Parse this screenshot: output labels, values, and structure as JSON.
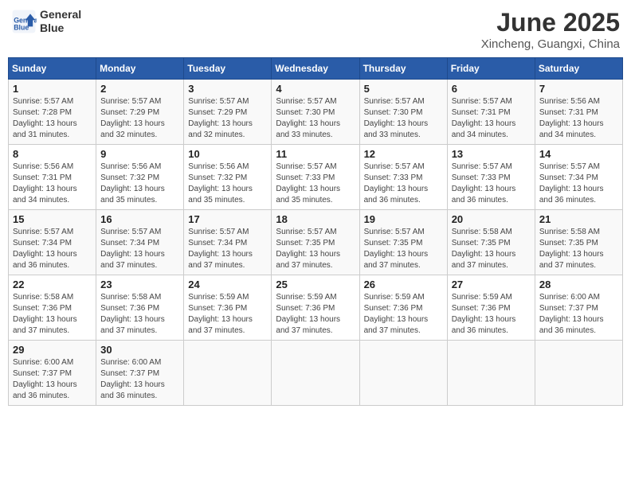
{
  "header": {
    "logo_line1": "General",
    "logo_line2": "Blue",
    "title": "June 2025",
    "subtitle": "Xincheng, Guangxi, China"
  },
  "weekdays": [
    "Sunday",
    "Monday",
    "Tuesday",
    "Wednesday",
    "Thursday",
    "Friday",
    "Saturday"
  ],
  "weeks": [
    [
      {
        "day": 1,
        "info": "Sunrise: 5:57 AM\nSunset: 7:28 PM\nDaylight: 13 hours\nand 31 minutes."
      },
      {
        "day": 2,
        "info": "Sunrise: 5:57 AM\nSunset: 7:29 PM\nDaylight: 13 hours\nand 32 minutes."
      },
      {
        "day": 3,
        "info": "Sunrise: 5:57 AM\nSunset: 7:29 PM\nDaylight: 13 hours\nand 32 minutes."
      },
      {
        "day": 4,
        "info": "Sunrise: 5:57 AM\nSunset: 7:30 PM\nDaylight: 13 hours\nand 33 minutes."
      },
      {
        "day": 5,
        "info": "Sunrise: 5:57 AM\nSunset: 7:30 PM\nDaylight: 13 hours\nand 33 minutes."
      },
      {
        "day": 6,
        "info": "Sunrise: 5:57 AM\nSunset: 7:31 PM\nDaylight: 13 hours\nand 34 minutes."
      },
      {
        "day": 7,
        "info": "Sunrise: 5:56 AM\nSunset: 7:31 PM\nDaylight: 13 hours\nand 34 minutes."
      }
    ],
    [
      {
        "day": 8,
        "info": "Sunrise: 5:56 AM\nSunset: 7:31 PM\nDaylight: 13 hours\nand 34 minutes."
      },
      {
        "day": 9,
        "info": "Sunrise: 5:56 AM\nSunset: 7:32 PM\nDaylight: 13 hours\nand 35 minutes."
      },
      {
        "day": 10,
        "info": "Sunrise: 5:56 AM\nSunset: 7:32 PM\nDaylight: 13 hours\nand 35 minutes."
      },
      {
        "day": 11,
        "info": "Sunrise: 5:57 AM\nSunset: 7:33 PM\nDaylight: 13 hours\nand 35 minutes."
      },
      {
        "day": 12,
        "info": "Sunrise: 5:57 AM\nSunset: 7:33 PM\nDaylight: 13 hours\nand 36 minutes."
      },
      {
        "day": 13,
        "info": "Sunrise: 5:57 AM\nSunset: 7:33 PM\nDaylight: 13 hours\nand 36 minutes."
      },
      {
        "day": 14,
        "info": "Sunrise: 5:57 AM\nSunset: 7:34 PM\nDaylight: 13 hours\nand 36 minutes."
      }
    ],
    [
      {
        "day": 15,
        "info": "Sunrise: 5:57 AM\nSunset: 7:34 PM\nDaylight: 13 hours\nand 36 minutes."
      },
      {
        "day": 16,
        "info": "Sunrise: 5:57 AM\nSunset: 7:34 PM\nDaylight: 13 hours\nand 37 minutes."
      },
      {
        "day": 17,
        "info": "Sunrise: 5:57 AM\nSunset: 7:34 PM\nDaylight: 13 hours\nand 37 minutes."
      },
      {
        "day": 18,
        "info": "Sunrise: 5:57 AM\nSunset: 7:35 PM\nDaylight: 13 hours\nand 37 minutes."
      },
      {
        "day": 19,
        "info": "Sunrise: 5:57 AM\nSunset: 7:35 PM\nDaylight: 13 hours\nand 37 minutes."
      },
      {
        "day": 20,
        "info": "Sunrise: 5:58 AM\nSunset: 7:35 PM\nDaylight: 13 hours\nand 37 minutes."
      },
      {
        "day": 21,
        "info": "Sunrise: 5:58 AM\nSunset: 7:35 PM\nDaylight: 13 hours\nand 37 minutes."
      }
    ],
    [
      {
        "day": 22,
        "info": "Sunrise: 5:58 AM\nSunset: 7:36 PM\nDaylight: 13 hours\nand 37 minutes."
      },
      {
        "day": 23,
        "info": "Sunrise: 5:58 AM\nSunset: 7:36 PM\nDaylight: 13 hours\nand 37 minutes."
      },
      {
        "day": 24,
        "info": "Sunrise: 5:59 AM\nSunset: 7:36 PM\nDaylight: 13 hours\nand 37 minutes."
      },
      {
        "day": 25,
        "info": "Sunrise: 5:59 AM\nSunset: 7:36 PM\nDaylight: 13 hours\nand 37 minutes."
      },
      {
        "day": 26,
        "info": "Sunrise: 5:59 AM\nSunset: 7:36 PM\nDaylight: 13 hours\nand 37 minutes."
      },
      {
        "day": 27,
        "info": "Sunrise: 5:59 AM\nSunset: 7:36 PM\nDaylight: 13 hours\nand 36 minutes."
      },
      {
        "day": 28,
        "info": "Sunrise: 6:00 AM\nSunset: 7:37 PM\nDaylight: 13 hours\nand 36 minutes."
      }
    ],
    [
      {
        "day": 29,
        "info": "Sunrise: 6:00 AM\nSunset: 7:37 PM\nDaylight: 13 hours\nand 36 minutes."
      },
      {
        "day": 30,
        "info": "Sunrise: 6:00 AM\nSunset: 7:37 PM\nDaylight: 13 hours\nand 36 minutes."
      },
      null,
      null,
      null,
      null,
      null
    ]
  ]
}
